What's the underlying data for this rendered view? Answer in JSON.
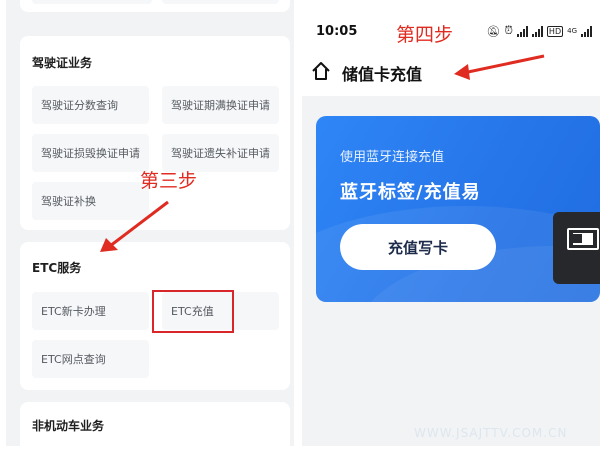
{
  "left_panel": {
    "driving_license": {
      "title": "驾驶证业务",
      "items": [
        "驾驶证分数查询",
        "驾驶证期满换证申请",
        "驾驶证损毁换证申请",
        "驾驶证遗失补证申请",
        "驾驶证补换"
      ]
    },
    "etc": {
      "title": "ETC服务",
      "items": [
        "ETC新卡办理",
        "ETC充值",
        "ETC网点查询"
      ]
    },
    "non_motor": {
      "title": "非机动车业务"
    },
    "annotation_step3": "第三步"
  },
  "right_panel": {
    "status_bar": {
      "time": "10:05",
      "hd_label": "HD",
      "network_label": "4G"
    },
    "header": {
      "title": "储值卡充值"
    },
    "annotation_step4": "第四步",
    "banner": {
      "subtitle": "使用蓝牙连接充值",
      "headline": "蓝牙标签/充值易",
      "button_label": "充值写卡"
    },
    "watermark": "WWW.JSAJTTV.COM.CN"
  },
  "colors": {
    "annotation_red": "#e02b20",
    "banner_blue": "#2574e8",
    "page_bg": "#f2f3f5"
  }
}
